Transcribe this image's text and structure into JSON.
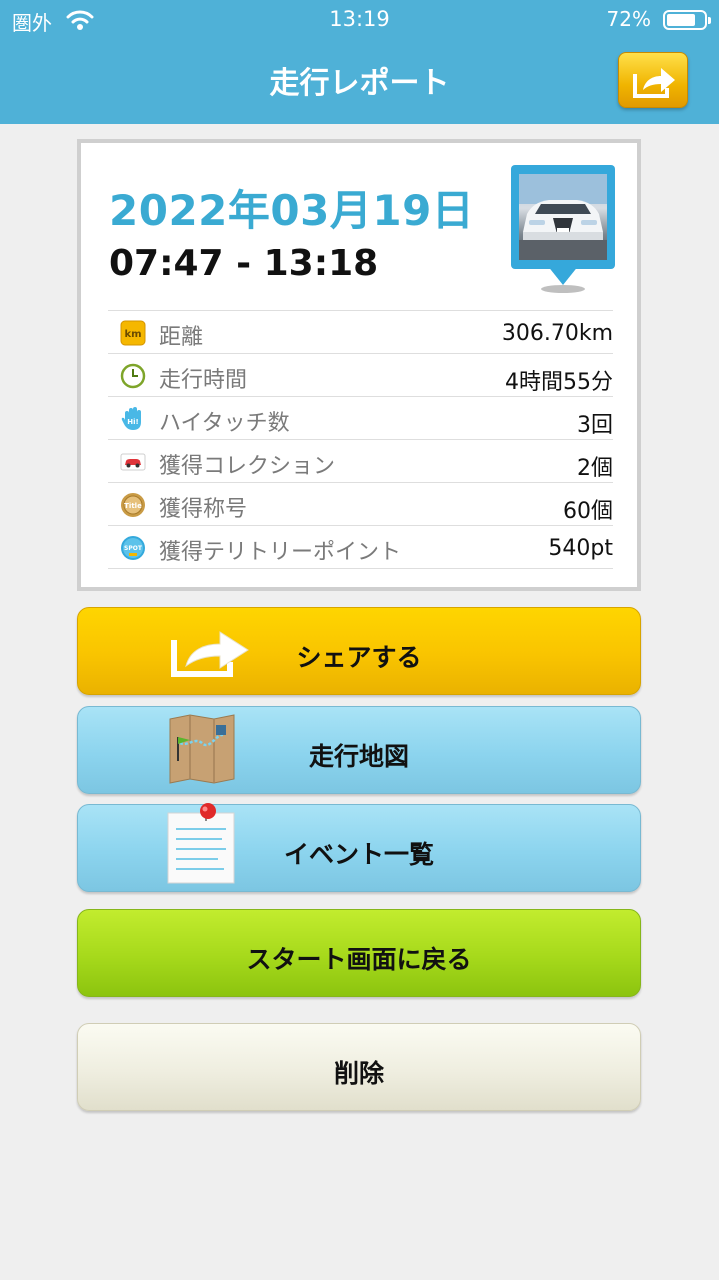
{
  "status_bar": {
    "carrier": "圏外",
    "time": "13:19",
    "battery": "72%"
  },
  "nav": {
    "title": "走行レポート"
  },
  "report": {
    "date": "2022年03月19日",
    "time_range": "07:47 - 13:18",
    "stats": [
      {
        "icon": "km-icon",
        "label": "距離",
        "value": "306.70km"
      },
      {
        "icon": "clock-icon",
        "label": "走行時間",
        "value": "4時間55分"
      },
      {
        "icon": "hand-icon",
        "label": "ハイタッチ数",
        "value": "3回"
      },
      {
        "icon": "car-card-icon",
        "label": "獲得コレクション",
        "value": "2個"
      },
      {
        "icon": "medal-icon",
        "label": "獲得称号",
        "value": "60個"
      },
      {
        "icon": "spot-icon",
        "label": "獲得テリトリーポイント",
        "value": "540pt"
      }
    ]
  },
  "buttons": {
    "share": "シェアする",
    "map": "走行地図",
    "events": "イベント一覧",
    "back_to_start": "スタート画面に戻る",
    "delete": "削除"
  },
  "colors": {
    "header": "#4fb1d7",
    "date": "#3aaad2",
    "share": "#f9c400",
    "blue_button": "#8cd4ee",
    "green_button": "#a6d91b",
    "gray_button": "#efeee0"
  }
}
